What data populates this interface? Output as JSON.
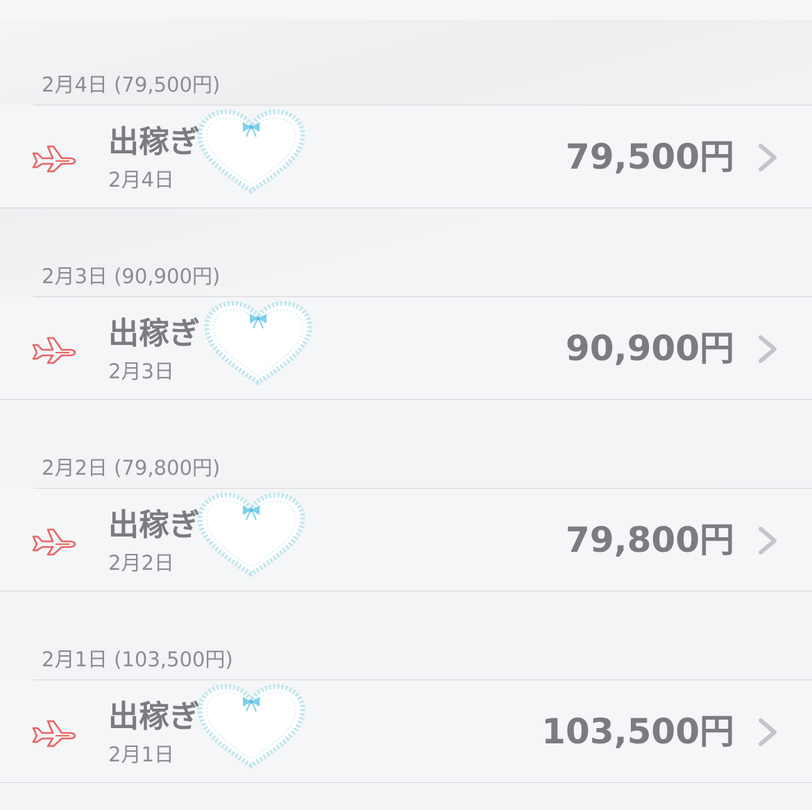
{
  "colors": {
    "plane_icon": "#ea6565",
    "heart_lace": "#bfe6ef",
    "bow": "#7fd0ea",
    "chevron": "#c4c4c9",
    "text_primary": "#7b7b80",
    "text_secondary": "#8d8d92"
  },
  "sections": [
    {
      "header": "2月4日 (79,500円)",
      "row": {
        "icon": "airplane-icon",
        "title": "出稼ぎ",
        "subtitle": "2月4日",
        "amount": "79,500円",
        "chevron": "chevron-right-icon"
      }
    },
    {
      "header": "2月3日 (90,900円)",
      "row": {
        "icon": "airplane-icon",
        "title": "出稼ぎ",
        "subtitle": "2月3日",
        "amount": "90,900円",
        "chevron": "chevron-right-icon"
      }
    },
    {
      "header": "2月2日 (79,800円)",
      "row": {
        "icon": "airplane-icon",
        "title": "出稼ぎ",
        "subtitle": "2月2日",
        "amount": "79,800円",
        "chevron": "chevron-right-icon"
      }
    },
    {
      "header": "2月1日 (103,500円)",
      "row": {
        "icon": "airplane-icon",
        "title": "出稼ぎ",
        "subtitle": "2月1日",
        "amount": "103,500円",
        "chevron": "chevron-right-icon"
      }
    }
  ]
}
